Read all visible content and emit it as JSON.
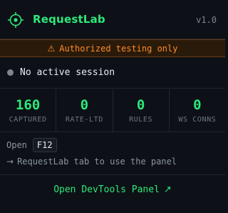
{
  "header": {
    "title": "RequestLab",
    "version": "v1.0",
    "logo_icon": "crosshair-target-icon",
    "accent": "#2ee87a"
  },
  "banner": {
    "icon": "warning-icon",
    "icon_glyph": "⚠",
    "text": "Authorized testing only",
    "color": "#ff8c2a"
  },
  "session": {
    "status_text": "No active session",
    "dot_color": "#7d8590"
  },
  "stats": [
    {
      "value": "160",
      "label": "CAPTURED"
    },
    {
      "value": "0",
      "label": "RATE-LTD"
    },
    {
      "value": "0",
      "label": "RULES"
    },
    {
      "value": "0",
      "label": "WS CONNS"
    }
  ],
  "hint": {
    "prefix": "Open",
    "key": "F12",
    "arrow_glyph": "→",
    "line2": "RequestLab tab to use the panel"
  },
  "open_button": {
    "label": "Open DevTools Panel",
    "icon_glyph": "↗"
  }
}
